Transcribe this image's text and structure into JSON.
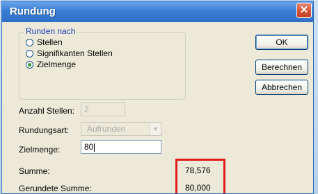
{
  "window": {
    "title": "Rundung"
  },
  "title_close_glyph": "✕",
  "group": {
    "legend": "Runden nach",
    "options": [
      {
        "label": "Stellen",
        "checked": false
      },
      {
        "label": "Signifikanten Stellen",
        "checked": false
      },
      {
        "label": "Zielmenge",
        "checked": true
      }
    ]
  },
  "fields": {
    "anzahl_stellen": {
      "label": "Anzahl Stellen:",
      "value": "2",
      "disabled": true
    },
    "rundungsart": {
      "label": "Rundungsart:",
      "value": "Aufrunden",
      "disabled": true
    },
    "zielmenge": {
      "label": "Zielmenge:",
      "value": "80"
    }
  },
  "buttons": {
    "ok": "OK",
    "berechnen": "Berechnen",
    "abbrechen": "Abbrechen"
  },
  "results": {
    "summe": {
      "label": "Summe:",
      "value": "78,576"
    },
    "gerundete_summe": {
      "label": "Gerundete Summe:",
      "value": "80,000"
    }
  },
  "highlight_color": "#e01b1b"
}
